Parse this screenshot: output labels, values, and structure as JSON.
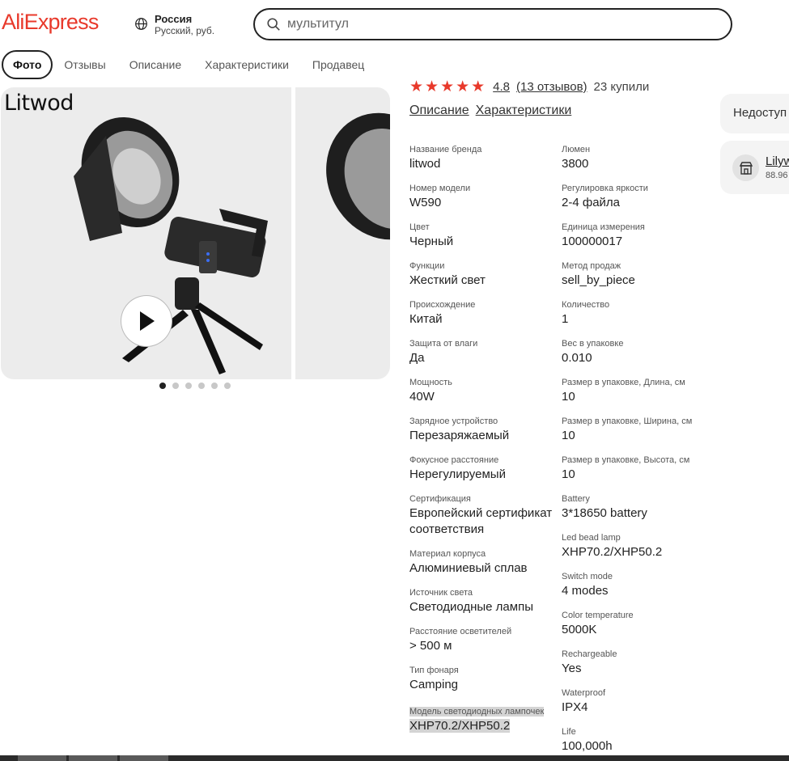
{
  "header": {
    "logo": "AliExpress",
    "region_country": "Россия",
    "region_lang": "Русский, руб.",
    "search_value": "мультитул"
  },
  "tabs": [
    {
      "label": "Фото",
      "active": true
    },
    {
      "label": "Отзывы"
    },
    {
      "label": "Описание"
    },
    {
      "label": "Характеристики"
    },
    {
      "label": "Продавец"
    }
  ],
  "gallery": {
    "brand_logo": "Litwod",
    "dots_total": 6,
    "dots_active": 1
  },
  "product": {
    "rating": "4.8",
    "reviews": "(13 отзывов)",
    "bought": "23 купили",
    "links": [
      "Описание",
      "Характеристики"
    ]
  },
  "specs_left": [
    {
      "label": "Название бренда",
      "value": "litwod"
    },
    {
      "label": "Номер модели",
      "value": "W590"
    },
    {
      "label": "Цвет",
      "value": "Черный"
    },
    {
      "label": "Функции",
      "value": "Жесткий свет"
    },
    {
      "label": "Происхождение",
      "value": "Китай"
    },
    {
      "label": "Защита от влаги",
      "value": "Да"
    },
    {
      "label": "Мощность",
      "value": "40W"
    },
    {
      "label": "Зарядное устройство",
      "value": "Перезаряжаемый"
    },
    {
      "label": "Фокусное расстояние",
      "value": "Нерегулируемый"
    },
    {
      "label": "Сертификация",
      "value": "Европейский сертификат соответствия"
    },
    {
      "label": "Материал корпуса",
      "value": "Алюминиевый сплав"
    },
    {
      "label": "Источник света",
      "value": "Светодиодные лампы"
    },
    {
      "label": "Расстояние осветителей",
      "value": "> 500 м"
    },
    {
      "label": "Тип фонаря",
      "value": "Camping"
    },
    {
      "label": "Модель светодиодных лампочек",
      "value": "XHP70.2/XHP50.2",
      "highlighted": true
    }
  ],
  "specs_right": [
    {
      "label": "Люмен",
      "value": "3800"
    },
    {
      "label": "Регулировка яркости",
      "value": "2-4 файла"
    },
    {
      "label": "Единица измерения",
      "value": "100000017"
    },
    {
      "label": "Метод продаж",
      "value": "sell_by_piece"
    },
    {
      "label": "Количество",
      "value": "1"
    },
    {
      "label": "Вес в упаковке",
      "value": "0.010"
    },
    {
      "label": "Размер в упаковке, Длина, см",
      "value": "10"
    },
    {
      "label": "Размер в упаковке, Ширина, см",
      "value": "10"
    },
    {
      "label": "Размер в упаковке, Высота, см",
      "value": "10"
    },
    {
      "label": "Battery",
      "value": "3*18650 battery"
    },
    {
      "label": "Led bead lamp",
      "value": "XHP70.2/XHP50.2"
    },
    {
      "label": "Switch mode",
      "value": "4 modes"
    },
    {
      "label": "Color temperature",
      "value": "5000K"
    },
    {
      "label": "Rechargeable",
      "value": "Yes"
    },
    {
      "label": "Waterproof",
      "value": "IPX4"
    },
    {
      "label": "Life",
      "value": "100,000h"
    }
  ],
  "sidebar": {
    "unavailable": "Недоступ",
    "seller_name": "Lilyw",
    "seller_rating": "88.96"
  },
  "colors": {
    "brand": "#e8392b",
    "stars": "#e8392b"
  }
}
